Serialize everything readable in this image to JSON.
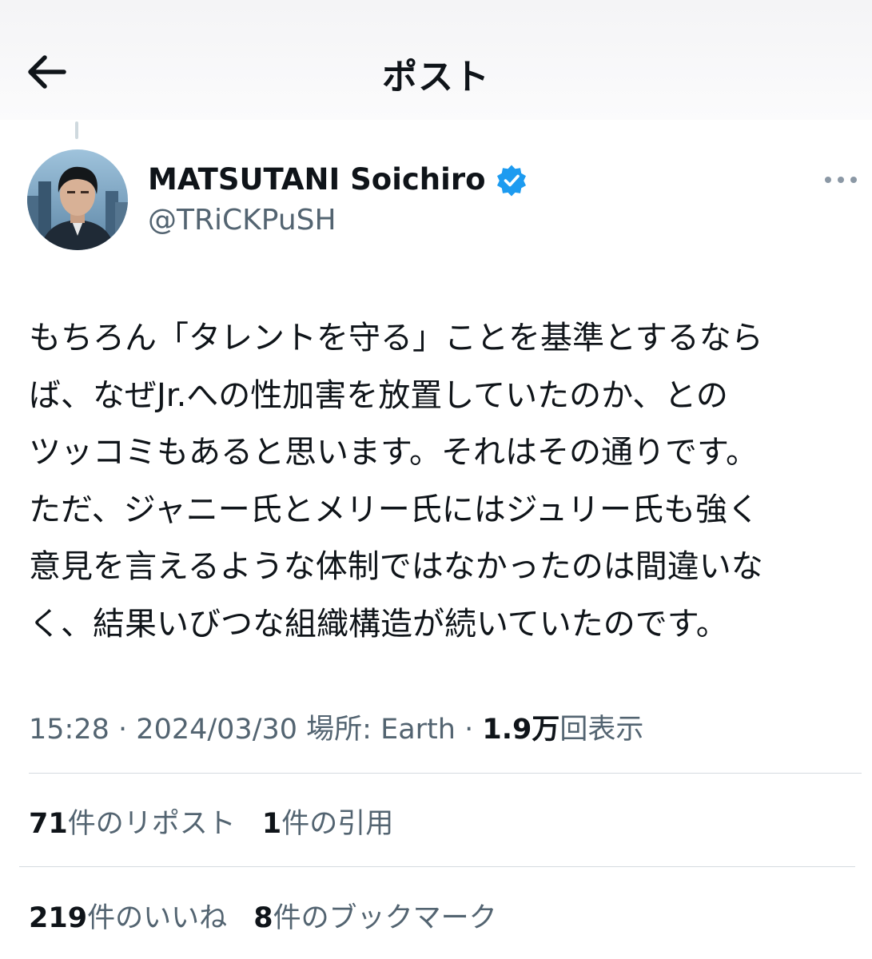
{
  "header": {
    "title": "ポスト",
    "back_icon": "arrow-left-icon"
  },
  "author": {
    "name": "MATSUTANI Soichiro",
    "handle": "@TRiCKPuSH",
    "verified_icon": "verified-badge-icon",
    "verified_color": "#1d9bf0"
  },
  "post": {
    "lines": [
      "もちろん「タレントを守る」ことを基準とするなら",
      "ば、なぜJr.への性加害を放置していたのか、との",
      "ツッコミもあると思います。それはその通りです。",
      "ただ、ジャニー氏とメリー氏にはジュリー氏も強く",
      "意見を言えるような体制ではなかったのは間違いな",
      "く、結果いびつな組織構造が続いていたのです。"
    ]
  },
  "meta": {
    "time": "15:28",
    "sep1": "·",
    "date": "2024/03/30",
    "location": "場所: Earth",
    "sep2": "·",
    "views_count": "1.9万",
    "views_label": "回表示"
  },
  "stats": {
    "reposts_count": "71",
    "reposts_label": "件のリポスト",
    "quotes_count": "1",
    "quotes_label": "件の引用",
    "likes_count": "219",
    "likes_label": "件のいいね",
    "bookmarks_count": "8",
    "bookmarks_label": "件のブックマーク"
  },
  "colors": {
    "text": "#0f1419",
    "secondary": "#536471",
    "divider": "#d5dbe0",
    "accent": "#1d9bf0"
  }
}
